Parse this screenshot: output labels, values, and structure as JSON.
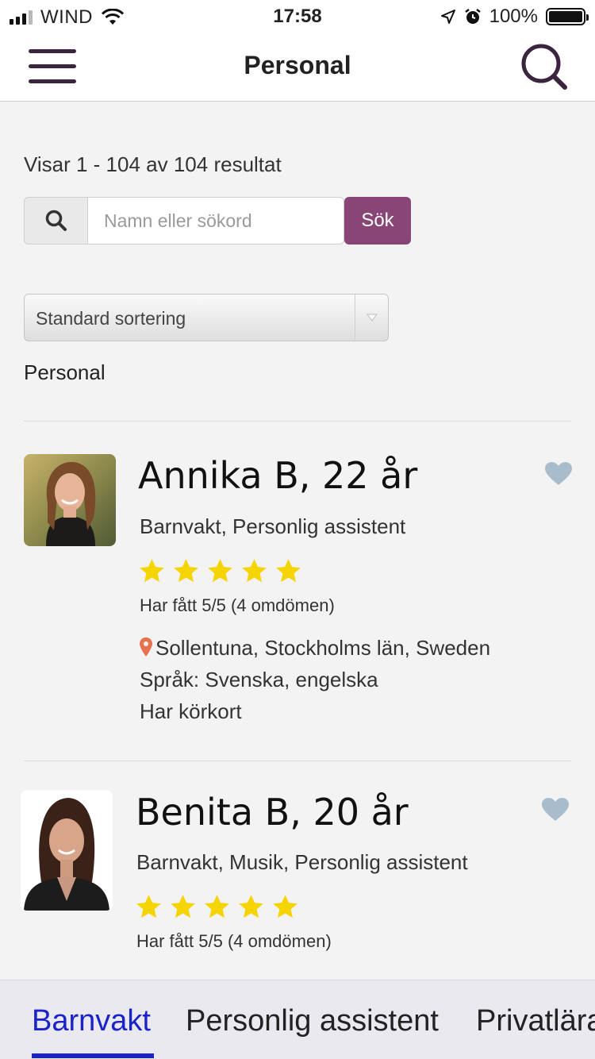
{
  "statusbar": {
    "carrier": "WIND",
    "time": "17:58",
    "battery": "100%",
    "battery_level": 1.0
  },
  "navbar": {
    "title": "Personal"
  },
  "results_text": "Visar 1 - 104 av 104 resultat",
  "search": {
    "placeholder": "Namn eller sökord",
    "button_label": "Sök"
  },
  "sort": {
    "selected": "Standard sortering"
  },
  "section_label": "Personal",
  "profiles": [
    {
      "name": "Annika B, 22 år",
      "roles": "Barnvakt, Personlig assistent",
      "stars": 5,
      "rating_text": "Har fått 5/5 (4 omdömen)",
      "location": "Sollentuna, Stockholms län, Sweden",
      "languages": "Språk: Svenska, engelska",
      "license": "Har körkort"
    },
    {
      "name": "Benita B, 20 år",
      "roles": "Barnvakt, Musik, Personlig assistent",
      "stars": 5,
      "rating_text": "Har fått 5/5 (4 omdömen)"
    }
  ],
  "tabs": [
    {
      "label": "Barnvakt",
      "active": true
    },
    {
      "label": "Personlig assistent",
      "active": false
    },
    {
      "label": "Privatlärare",
      "active": false
    }
  ],
  "colors": {
    "accent": "#8a4577",
    "nav_icon": "#3c2340",
    "star": "#f5d400",
    "pin": "#e8714f",
    "heart": "#a9bccb",
    "tab_active": "#1a22c8"
  }
}
